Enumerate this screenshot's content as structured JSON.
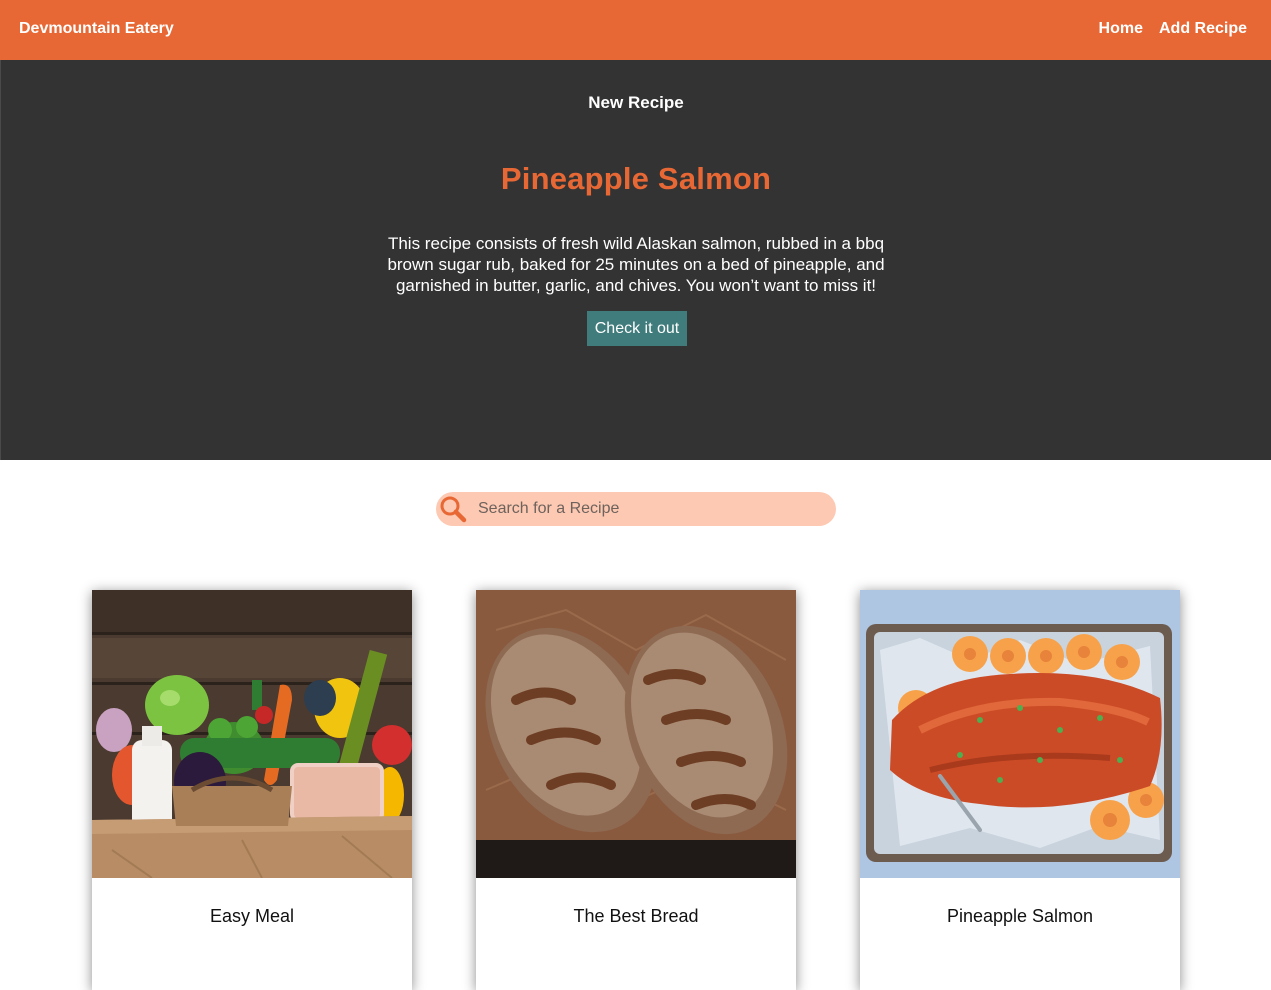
{
  "header": {
    "brand": "Devmountain Eatery",
    "nav": [
      "Home",
      "Add Recipe"
    ]
  },
  "hero": {
    "eyebrow": "New Recipe",
    "title": "Pineapple Salmon",
    "description": "This recipe consists of fresh wild Alaskan salmon, rubbed in a bbq brown sugar rub, baked for 25 minutes on a bed of pineapple, and garnished in butter, garlic, and chives. You won’t want to miss it!",
    "button": "Check it out"
  },
  "search": {
    "placeholder": "Search for a Recipe",
    "icon": "search-icon"
  },
  "cards": [
    {
      "title": "Easy Meal",
      "image": "grocery-bag-vegetables"
    },
    {
      "title": "The Best Bread",
      "image": "bread-loaves"
    },
    {
      "title": "Pineapple Salmon",
      "image": "salmon-on-pineapple"
    }
  ],
  "colors": {
    "accent": "#e76835",
    "hero_bg": "#333333",
    "button": "#407c7c",
    "search_bg": "#fdc9b2"
  }
}
